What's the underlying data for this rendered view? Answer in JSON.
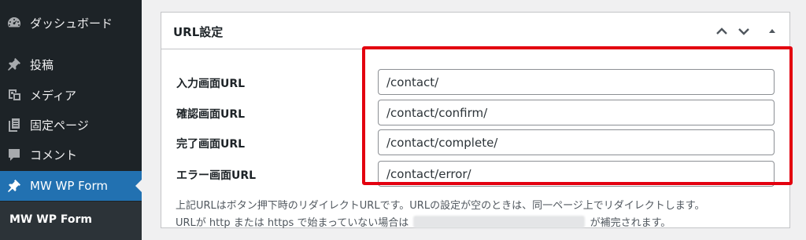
{
  "sidebar": {
    "items": [
      {
        "label": "ダッシュボード",
        "icon": "dashboard-icon"
      },
      {
        "label": "投稿",
        "icon": "pin-icon"
      },
      {
        "label": "メディア",
        "icon": "media-icon"
      },
      {
        "label": "固定ページ",
        "icon": "pages-icon"
      },
      {
        "label": "コメント",
        "icon": "comment-icon"
      },
      {
        "label": "MW WP Form",
        "icon": "pin-icon"
      }
    ],
    "submenu": {
      "label": "MW WP Form"
    },
    "active_color": "#2271b1"
  },
  "postbox": {
    "title": "URL設定",
    "controls": [
      "chevron-up-icon",
      "chevron-down-icon",
      "triangle-up-icon"
    ],
    "fields": [
      {
        "label": "入力画面URL",
        "value": "/contact/"
      },
      {
        "label": "確認画面URL",
        "value": "/contact/confirm/"
      },
      {
        "label": "完了画面URL",
        "value": "/contact/complete/"
      },
      {
        "label": "エラー画面URL",
        "value": "/contact/error/"
      }
    ],
    "description": {
      "line1": "上記URLはボタン押下時のリダイレクトURLです。URLの設定が空のときは、同一ページ上でリダイレクトします。",
      "line2_before": "URLが http または https で始まっていない場合は",
      "line2_after": "が補完されます。"
    }
  },
  "highlight_color": "#e3000f"
}
